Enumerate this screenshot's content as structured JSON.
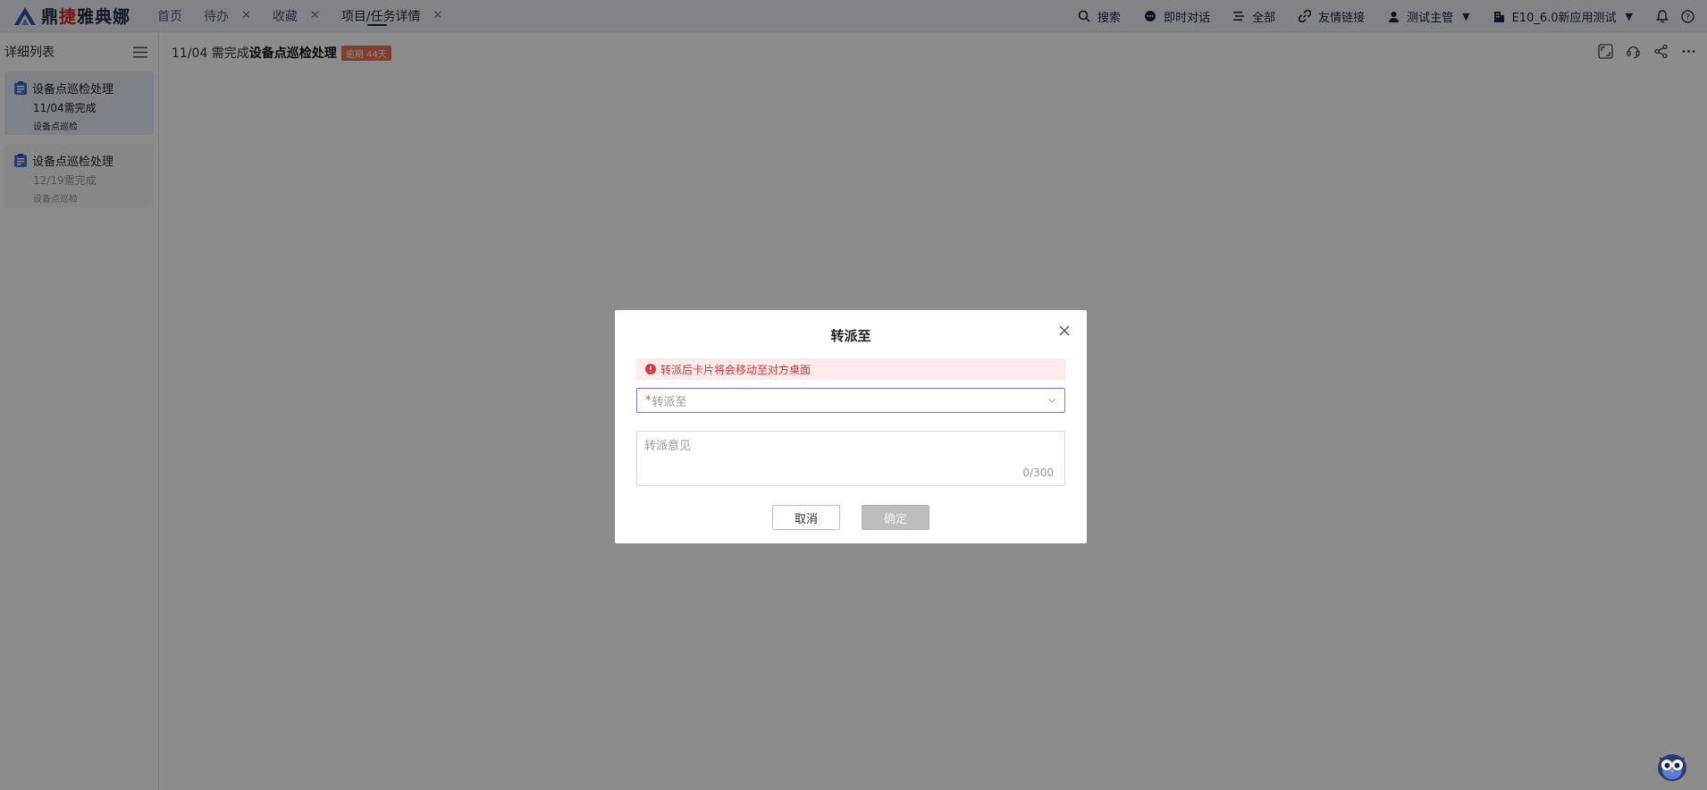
{
  "app": {
    "logo_text_a": "鼎",
    "logo_text_hl": "捷",
    "logo_text_b": "雅典娜"
  },
  "tabs": [
    {
      "label": "首页",
      "closable": false
    },
    {
      "label": "待办",
      "closable": true
    },
    {
      "label": "收藏",
      "closable": true
    },
    {
      "label": "项目/任务详情",
      "closable": true,
      "active": true
    }
  ],
  "topbar": {
    "search": "搜索",
    "chat": "即时对话",
    "all": "全部",
    "links": "友情链接",
    "user": "测试主管",
    "tenant": "E10_6.0新应用测试"
  },
  "sidebar": {
    "title": "详细列表",
    "cards": [
      {
        "title": "设备点巡检处理",
        "due": "11/04需完成",
        "tag": "设备点巡检",
        "selected": true
      },
      {
        "title": "设备点巡检处理",
        "due": "12/19需完成",
        "tag": "设备点巡检",
        "selected": false
      }
    ]
  },
  "main": {
    "date": "11/04 需完成",
    "title": "设备点巡检处理",
    "badge": "逾期 44天"
  },
  "modal": {
    "title": "转派至",
    "alert": "转派后卡片将会移动至对方桌面",
    "select_required_mark": "*",
    "select_placeholder": "转派至",
    "textarea_placeholder": "转派意见",
    "counter": "0/300",
    "cancel": "取消",
    "confirm": "确定"
  },
  "colors": {
    "accent": "#7d75d9",
    "danger": "#d9363e",
    "badge": "#f06d4f",
    "card_icon": "#4b6fd6"
  }
}
